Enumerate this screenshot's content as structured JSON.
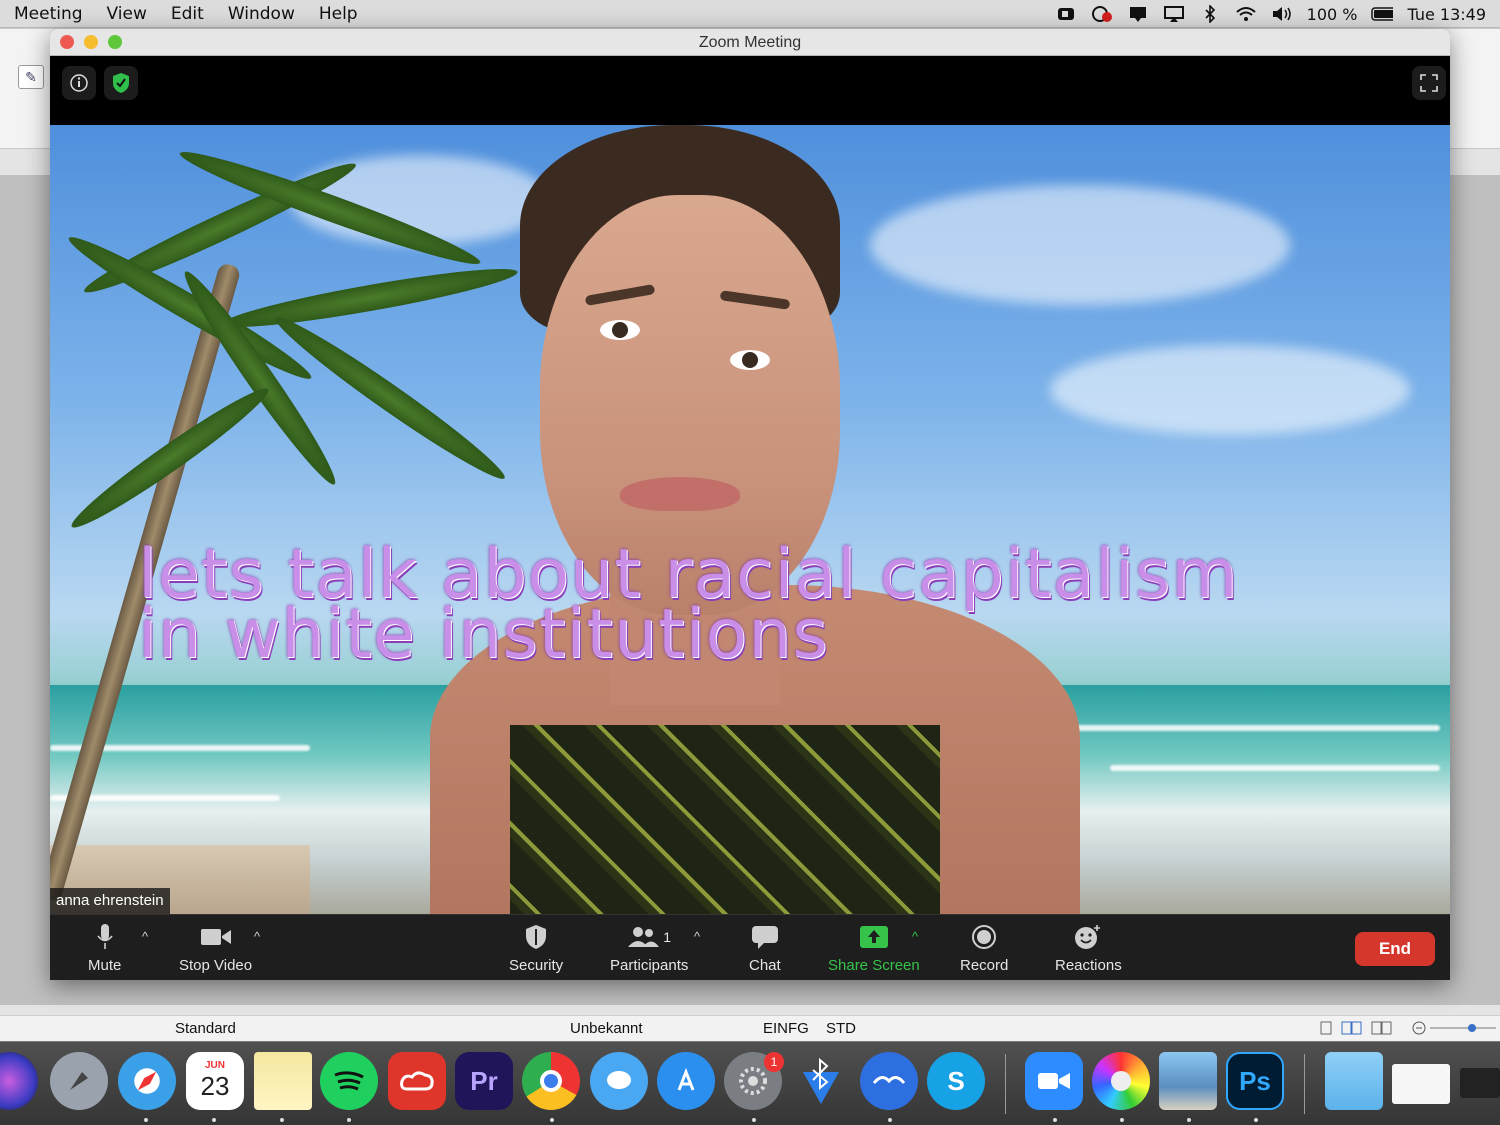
{
  "menubar": {
    "items": [
      "Meeting",
      "View",
      "Edit",
      "Window",
      "Help"
    ],
    "battery": "100 %",
    "clock": "Tue 13:49"
  },
  "window": {
    "title": "Zoom Meeting"
  },
  "video": {
    "overlay_line1": "lets talk about racial capitalism",
    "overlay_line2": "in white institutions",
    "participant_name": "anna ehrenstein"
  },
  "controls": {
    "mute": "Mute",
    "stop_video": "Stop Video",
    "security": "Security",
    "participants": "Participants",
    "participants_count": "1",
    "chat": "Chat",
    "share_screen": "Share Screen",
    "record": "Record",
    "reactions": "Reactions",
    "end": "End"
  },
  "background_app_status": {
    "style": "Standard",
    "language": "Unbekannt",
    "mode1": "EINFG",
    "mode2": "STD"
  },
  "dock": {
    "calendar_month": "JUN",
    "calendar_day": "23",
    "settings_badge": "1",
    "premiere": "Pr",
    "photoshop": "Ps",
    "skype": "S"
  },
  "colors": {
    "end_button": "#d5372c",
    "share_green": "#36c34a",
    "overlay_text": "#c98ee8"
  }
}
